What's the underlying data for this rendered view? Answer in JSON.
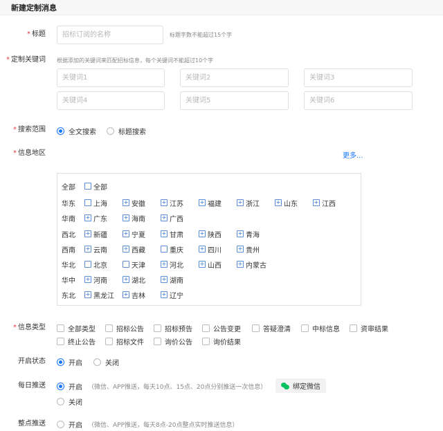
{
  "header": {
    "title": "新建定制消息"
  },
  "title_field": {
    "label": "标题",
    "placeholder": "招标订阅的名称",
    "hint": "标题字数不能超过15个字"
  },
  "keywords": {
    "label": "定制关键词",
    "hint": "根据添加的关键词来匹配招标信息，每个关键词不能超过10个字",
    "placeholders": [
      "关键词1",
      "关键词2",
      "关键词3",
      "关键词4",
      "关键词5",
      "关键词6"
    ]
  },
  "search_scope": {
    "label": "搜索范围",
    "options": [
      {
        "label": "全文搜索",
        "checked": true
      },
      {
        "label": "标题搜索",
        "checked": false
      }
    ]
  },
  "region": {
    "label": "信息地区",
    "more": "更多...",
    "rows": [
      {
        "label": "全部",
        "items": [
          {
            "name": "全部",
            "expand": false
          }
        ]
      },
      {
        "label": "华东",
        "items": [
          {
            "name": "上海",
            "expand": false
          },
          {
            "name": "安徽",
            "expand": true
          },
          {
            "name": "江苏",
            "expand": true
          },
          {
            "name": "福建",
            "expand": true
          },
          {
            "name": "浙江",
            "expand": true
          },
          {
            "name": "山东",
            "expand": true
          },
          {
            "name": "江西",
            "expand": true
          }
        ]
      },
      {
        "label": "华南",
        "items": [
          {
            "name": "广东",
            "expand": true
          },
          {
            "name": "海南",
            "expand": true
          },
          {
            "name": "广西",
            "expand": true
          }
        ]
      },
      {
        "label": "西北",
        "items": [
          {
            "name": "新疆",
            "expand": true
          },
          {
            "name": "宁夏",
            "expand": true
          },
          {
            "name": "甘肃",
            "expand": true
          },
          {
            "name": "陕西",
            "expand": true
          },
          {
            "name": "青海",
            "expand": true
          }
        ]
      },
      {
        "label": "西南",
        "items": [
          {
            "name": "云南",
            "expand": true
          },
          {
            "name": "西藏",
            "expand": true
          },
          {
            "name": "重庆",
            "expand": false
          },
          {
            "name": "四川",
            "expand": true
          },
          {
            "name": "贵州",
            "expand": true
          }
        ]
      },
      {
        "label": "华北",
        "items": [
          {
            "name": "北京",
            "expand": false
          },
          {
            "name": "天津",
            "expand": false
          },
          {
            "name": "河北",
            "expand": true
          },
          {
            "name": "山西",
            "expand": true
          },
          {
            "name": "内蒙古",
            "expand": true
          }
        ]
      },
      {
        "label": "华中",
        "items": [
          {
            "name": "河南",
            "expand": true
          },
          {
            "name": "湖北",
            "expand": true
          },
          {
            "name": "湖南",
            "expand": true
          }
        ]
      },
      {
        "label": "东北",
        "items": [
          {
            "name": "黑龙江",
            "expand": true
          },
          {
            "name": "吉林",
            "expand": true
          },
          {
            "name": "辽宁",
            "expand": true
          }
        ]
      }
    ]
  },
  "info_type": {
    "label": "信息类型",
    "row1": [
      "全部类型",
      "招标公告",
      "招标预告",
      "公告变更",
      "答疑澄清",
      "中标信息",
      "资审结果"
    ],
    "row2": [
      "终止公告",
      "招标文件",
      "询价公告",
      "询价结果"
    ]
  },
  "status": {
    "label": "开启状态",
    "options": [
      {
        "label": "开启",
        "checked": true
      },
      {
        "label": "关闭",
        "checked": false
      }
    ]
  },
  "daily_push": {
    "label": "每日推送",
    "on_label": "开启",
    "on_desc": "（微信、APP推送，每天10点、15点、20点分别推送一次信息）",
    "off_label": "关闭",
    "bind_wechat": "绑定微信"
  },
  "hourly_push": {
    "label": "整点推送",
    "on_label": "开启",
    "on_desc": "（微信、APP推送，每天8点-20点整点实时推送信息）"
  },
  "colors": {
    "accent": "#1677ff",
    "required": "#e4393c",
    "wechat": "#07c160"
  }
}
